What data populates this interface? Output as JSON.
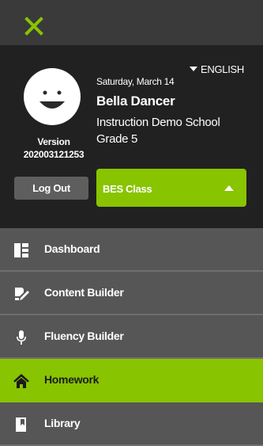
{
  "header": {
    "close_icon": "close-icon",
    "accent_color": "#89c400"
  },
  "profile": {
    "language": "ENGLISH",
    "date": "Saturday, March 14",
    "name": "Bella Dancer",
    "school": "Instruction Demo School",
    "grade": "Grade 5",
    "version_label": "Version",
    "version_number": "202003121253",
    "logout_label": "Log Out",
    "class_selected": "BES Class"
  },
  "nav": {
    "items": [
      {
        "label": "Dashboard",
        "icon": "dashboard-icon",
        "active": false
      },
      {
        "label": "Content Builder",
        "icon": "content-builder-icon",
        "active": false
      },
      {
        "label": "Fluency Builder",
        "icon": "microphone-icon",
        "active": false
      },
      {
        "label": "Homework",
        "icon": "home-icon",
        "active": true
      },
      {
        "label": "Library",
        "icon": "book-icon",
        "active": false
      }
    ]
  }
}
